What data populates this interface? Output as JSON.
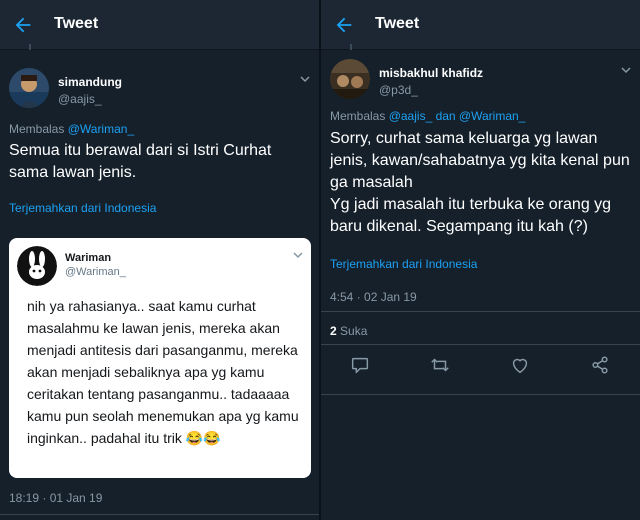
{
  "left": {
    "header": {
      "title": "Tweet"
    },
    "tweet": {
      "name": "simandung",
      "handle": "@aajis_",
      "reply_prefix": "Membalas",
      "reply_mentions": "@Wariman_",
      "body": "Semua itu berawal dari si Istri Curhat sama lawan jenis.",
      "translate": "Terjemahkan dari Indonesia",
      "quoted": {
        "name": "Wariman",
        "handle": "@Wariman_",
        "body": "nih ya rahasianya.. saat kamu curhat masalahmu ke lawan jenis, mereka akan menjadi antitesis dari pasanganmu, mereka akan menjadi sebaliknya apa yg kamu ceritakan tentang pasanganmu.. tadaaaaa kamu pun seolah menemukan apa yg kamu inginkan.. padahal itu trik 😂😂"
      },
      "timestamp": "18:19 · 01 Jan 19"
    }
  },
  "right": {
    "header": {
      "title": "Tweet"
    },
    "tweet": {
      "name": "misbakhul khafidz",
      "handle": "@p3d_",
      "reply_prefix": "Membalas",
      "reply_mentions": "@aajis_ dan @Wariman_",
      "body": "Sorry, curhat sama keluarga yg lawan jenis, kawan/sahabatnya yg kita kenal pun ga masalah\nYg jadi masalah itu terbuka ke orang yg baru dikenal. Segampang itu kah (?)",
      "translate": "Terjemahkan dari Indonesia",
      "timestamp": "4:54 · 02 Jan 19",
      "likes_count": "2",
      "likes_label": "Suka"
    },
    "actions": [
      "reply-icon",
      "retweet-icon",
      "like-icon",
      "share-icon"
    ]
  },
  "colors": {
    "background": "#15202b",
    "header": "#1c2733",
    "accent": "#1da1f2",
    "muted": "#8899a6",
    "text": "#ffffff"
  }
}
